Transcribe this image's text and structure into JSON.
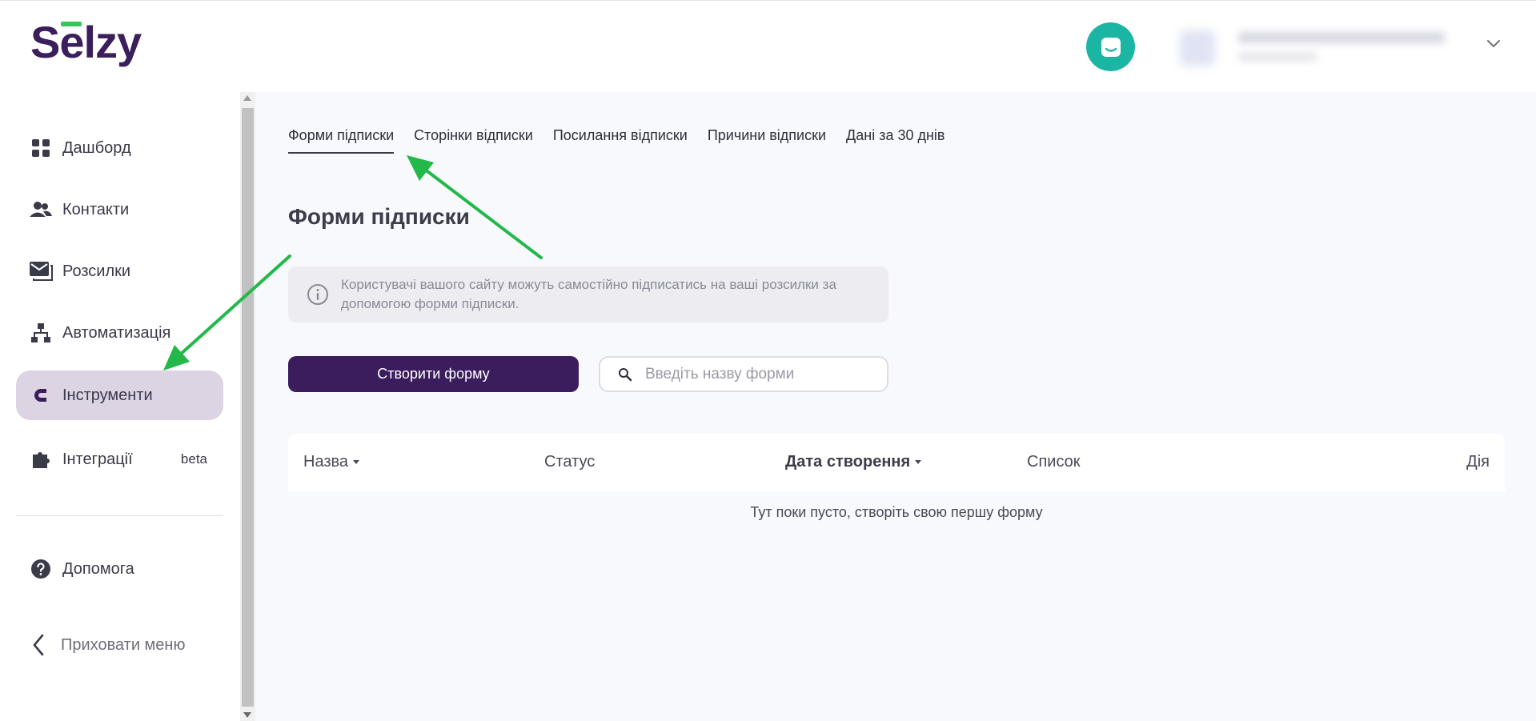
{
  "header": {
    "logo_text": "Selzy",
    "account_email": "",
    "account_subtitle": ""
  },
  "sidebar": {
    "items": [
      {
        "label": "Дашборд",
        "icon": "dashboard-icon"
      },
      {
        "label": "Контакти",
        "icon": "contacts-icon"
      },
      {
        "label": "Розсилки",
        "icon": "mail-icon"
      },
      {
        "label": "Автоматизація",
        "icon": "automation-icon"
      },
      {
        "label": "Інструменти",
        "icon": "magnet-icon",
        "active": true
      },
      {
        "label": "Інтеграції",
        "icon": "puzzle-icon",
        "badge": "beta"
      },
      {
        "label": "Допомога",
        "icon": "help-icon"
      }
    ],
    "hide_menu_label": "Приховати меню"
  },
  "tabs": [
    {
      "label": "Форми підписки",
      "active": true
    },
    {
      "label": "Сторінки відписки"
    },
    {
      "label": "Посилання відписки"
    },
    {
      "label": "Причини відписки"
    },
    {
      "label": "Дані за 30 днів"
    }
  ],
  "main": {
    "title": "Форми підписки",
    "info_text": "Користувачі вашого сайту можуть самостійно підписатись на ваші розсилки за допомогою форми підписки.",
    "create_button": "Створити форму",
    "search_placeholder": "Введіть назву форми",
    "table": {
      "columns": [
        "Назва",
        "Статус",
        "Дата створення",
        "Список",
        "Дія"
      ],
      "empty_text": "Тут поки пусто, створіть свою першу форму"
    }
  },
  "colors": {
    "brand": "#3b1d5e",
    "accent_green": "#35c65a",
    "chat_teal": "#1bb5a4",
    "active_nav_bg": "#dcd4e2",
    "annotation_arrow": "#22b84a"
  }
}
